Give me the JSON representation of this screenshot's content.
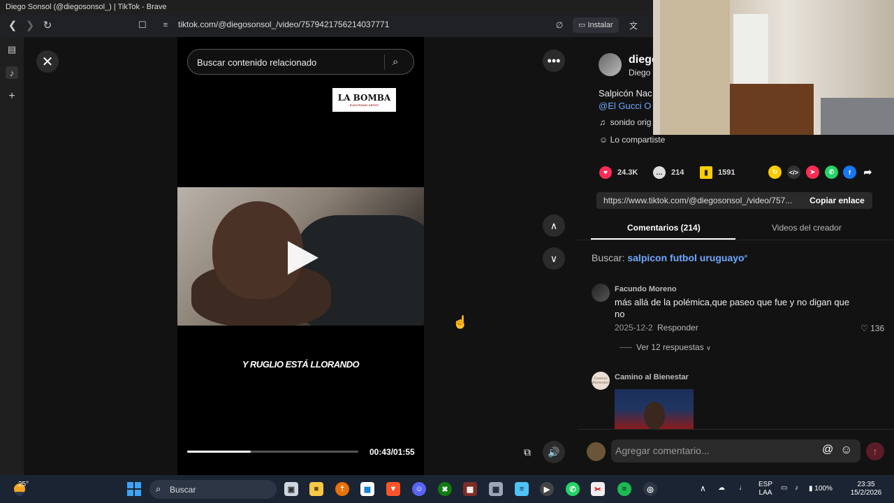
{
  "window": {
    "title": "Diego Sonsol (@diegosonsol_) | TikTok - Brave"
  },
  "browser": {
    "url": "tiktok.com/@diegosonsol_/video/7579421756214037771",
    "install_label": "Instalar"
  },
  "video": {
    "search_placeholder": "Buscar contenido relacionado",
    "logo_text": "LA BOMBA",
    "logo_subtext": "ELECTRONIC ARTIST",
    "caption": "Y RUGLIO ESTÁ LLORANDO",
    "time": "00:43/01:55",
    "progress": 0.37
  },
  "post": {
    "author_name": "diego",
    "author_sub": "Diego",
    "description": "Salpicón Nac",
    "mention": "@El Gucci O",
    "music": "sonido orig",
    "shared_label": "Lo compartiste"
  },
  "stats": {
    "likes": "24.3K",
    "comments": "214",
    "saves": "1591"
  },
  "share": {
    "link": "https://www.tiktok.com/@diegosonsol_/video/757...",
    "copy_label": "Copiar enlace"
  },
  "tabs": {
    "comments": "Comentarios (214)",
    "creator_videos": "Videos del creador"
  },
  "search_suggestion": {
    "prefix": "Buscar:",
    "query": "salpicon futbol uruguayo"
  },
  "comments": [
    {
      "author": "Facundo Moreno",
      "text": "más allá de la polémica,que paseo que fue y no digan que no",
      "date": "2025-12-2",
      "reply_label": "Responder",
      "likes": "136",
      "replies_label": "Ver 12 respuestas"
    },
    {
      "author": "Camino al Bienestar",
      "avatar_text": "Camino Bienestar"
    }
  ],
  "composer": {
    "placeholder": "Agregar comentario..."
  },
  "taskbar": {
    "temperature": "25°",
    "search_label": "Buscar",
    "lang_top": "ESP",
    "lang_bottom": "LAA",
    "battery": "100%",
    "time": "23:35",
    "date": "15/2/2026"
  },
  "colors": {
    "accent_link": "#6fa8ff",
    "like": "#fe2c55",
    "save": "#facd00"
  }
}
